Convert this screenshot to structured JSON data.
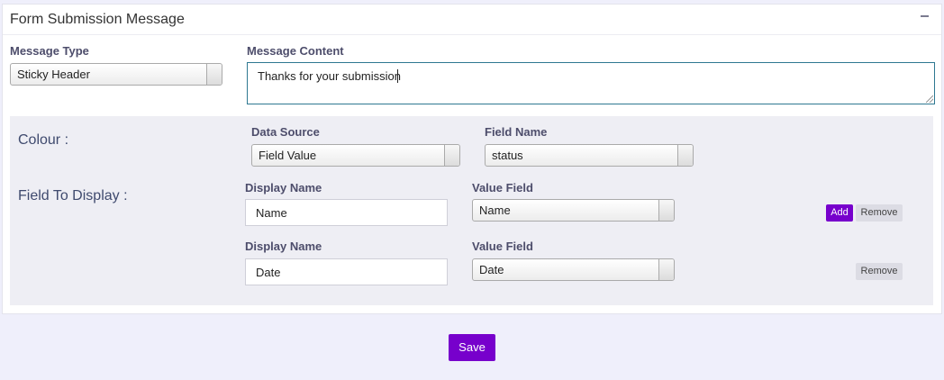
{
  "panel": {
    "title": "Form Submission Message"
  },
  "message_type": {
    "label": "Message Type",
    "selected": "Sticky Header"
  },
  "message_content": {
    "label": "Message Content",
    "value": "Thanks for your submission"
  },
  "colour": {
    "label": "Colour :",
    "data_source_label": "Data Source",
    "data_source_value": "Field Value",
    "field_name_label": "Field Name",
    "field_name_value": "status"
  },
  "field_to_display": {
    "label": "Field To Display :",
    "rows": [
      {
        "display_name_label": "Display Name",
        "display_name_value": "Name",
        "value_field_label": "Value Field",
        "value_field_value": "Name"
      },
      {
        "display_name_label": "Display Name",
        "display_name_value": "Date",
        "value_field_label": "Value Field",
        "value_field_value": "Date"
      }
    ],
    "add_label": "Add",
    "remove_label": "Remove"
  },
  "save_label": "Save",
  "colors": {
    "accent": "#7700cc",
    "page_bg": "#efeffb",
    "section_bg": "#eeeef4"
  }
}
